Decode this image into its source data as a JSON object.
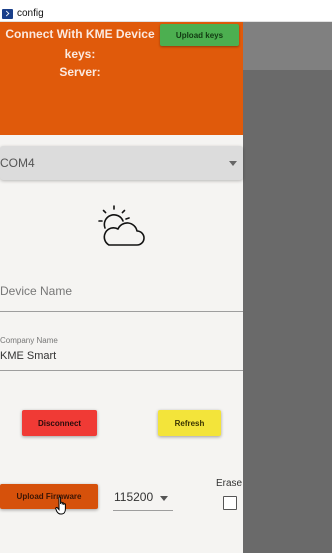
{
  "window": {
    "title": "config",
    "icon": "terminal-icon"
  },
  "header": {
    "line1": "Connect With KME Device",
    "line2": "keys:",
    "line3": "Server:",
    "upload_keys_label": "Upload keys",
    "background_color": "#e05a0b"
  },
  "port": {
    "value": "COM4"
  },
  "weather_icon": "partly-cloudy-icon",
  "device_name": {
    "placeholder": "Device Name",
    "value": ""
  },
  "company_name": {
    "label": "Company Name",
    "value": "KME Smart"
  },
  "buttons": {
    "disconnect": "Disconnect",
    "refresh": "Refresh",
    "upload_firmware": "Upload Firmware"
  },
  "baud": {
    "value": "115200"
  },
  "erase": {
    "label": "Erase",
    "checked": false
  },
  "colors": {
    "disconnect": "#f03a35",
    "refresh": "#f3e43a",
    "upload_firmware": "#d6510b",
    "upload_keys": "#4caf50"
  }
}
